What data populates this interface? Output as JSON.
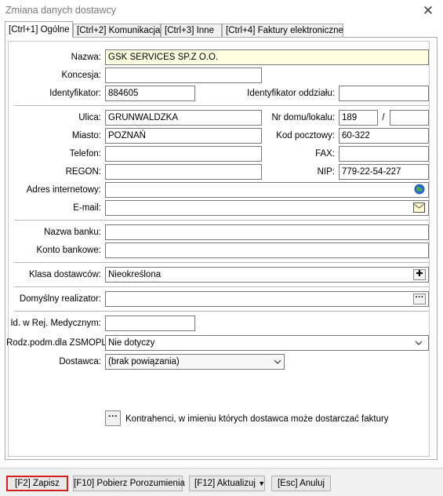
{
  "window": {
    "title": "Zmiana danych dostawcy"
  },
  "tabs": [
    "[Ctrl+1] Ogólne",
    "[Ctrl+2] Komunikacja",
    "[Ctrl+3] Inne",
    "[Ctrl+4] Faktury elektroniczne"
  ],
  "labels": {
    "nazwa": "Nazwa:",
    "koncesja": "Koncesja:",
    "identyfikator": "Identyfikator:",
    "identyfikator_oddzialu": "Identyfikator oddziału:",
    "ulica": "Ulica:",
    "nr_domu": "Nr domu/lokalu:",
    "miasto": "Miasto:",
    "kod_pocztowy": "Kod pocztowy:",
    "telefon": "Telefon:",
    "fax": "FAX:",
    "regon": "REGON:",
    "nip": "NIP:",
    "adres_internetowy": "Adres internetowy:",
    "email": "E-mail:",
    "nazwa_banku": "Nazwa banku:",
    "konto_bankowe": "Konto bankowe:",
    "klasa_dostawcow": "Klasa dostawców:",
    "domyslny_realizator": "Domyślny realizator:",
    "id_rej_medycznym": "Id. w Rej. Medycznym:",
    "rodz_podm": "Rodz.podm.dla ZSMOPL:",
    "dostawca": "Dostawca:"
  },
  "values": {
    "nazwa": "GSK SERVICES SP.Z O.O.",
    "koncesja": "",
    "identyfikator": "884605",
    "identyfikator_oddzialu": "",
    "ulica": "GRUNWALDZKA",
    "nr_domu": "189",
    "nr_lokalu": "",
    "slash": "/",
    "miasto": "POZNAŃ",
    "kod_pocztowy": "60-322",
    "telefon": "",
    "fax": "",
    "regon": "",
    "nip": "779-22-54-227",
    "adres_internetowy": "",
    "email": "",
    "nazwa_banku": "",
    "konto_bankowe": "",
    "klasa_dostawcow": "Nieokreślona",
    "domyslny_realizator": "",
    "id_rej_medycznym": "",
    "rodz_podm": "Nie dotyczy",
    "dostawca": "(brak powiązania)"
  },
  "kontrahenci_label": "Kontrahenci, w imieniu których dostawca może dostarczać faktury",
  "buttons": {
    "zapisz": "[F2] Zapisz",
    "pobierz": "[F10] Pobierz Porozumienia",
    "aktualizuj": "[F12] Aktualizuj",
    "anuluj": "[Esc] Anuluj"
  },
  "icons": {
    "globe": "globe-icon",
    "envelope": "envelope-icon",
    "plus": "plus-icon",
    "ellipsis": "ellipsis-icon",
    "chevron": "chevron-down-icon"
  },
  "colors": {
    "highlight_field": "#ffffe1",
    "focus_border": "#d02020",
    "globe": "#2a6fc9"
  }
}
